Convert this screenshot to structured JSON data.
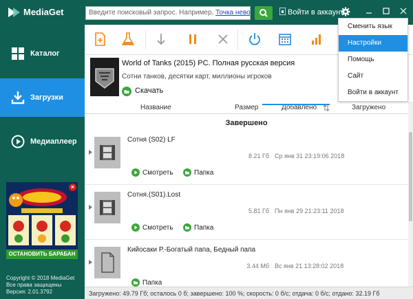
{
  "app": {
    "title": "MediaGet"
  },
  "search": {
    "placeholder": "Введите поисковый запрос. Например,",
    "example_link": "Точка невозврата"
  },
  "header": {
    "login": "Войти в аккаунт"
  },
  "sidebar": {
    "items": [
      {
        "label": "Каталог",
        "icon": "grid-icon"
      },
      {
        "label": "Загрузки",
        "icon": "download-icon",
        "active": true
      },
      {
        "label": "Медиаплеер",
        "icon": "play-icon"
      }
    ],
    "ad": {
      "button": "ОСТАНОВИТЬ БАРАБАН"
    },
    "copyright": [
      "Copyright © 2018 MediaGet",
      "Все права защищены",
      "Версия: 2.01.3792"
    ]
  },
  "banner": {
    "title": "World of Tanks (2015) PC. Полная русская версия",
    "subtitle": "Сотни танков, десятки карт, миллионы игроков",
    "download": "Скачать"
  },
  "columns": [
    "Название",
    "Размер",
    "Добавлено",
    "Загружено"
  ],
  "list": {
    "group": "Завершено",
    "rows": [
      {
        "name": "Сотня (S02) LF",
        "size": "8.21 Гб",
        "date": "Ср янв 31 23:19:06 2018",
        "watch": "Смотреть",
        "folder": "Папка",
        "type": "video"
      },
      {
        "name": "Сотня.(S01).Lost",
        "size": "5.81 Гб",
        "date": "Пн янв 29 21:23:11 2018",
        "watch": "Смотреть",
        "folder": "Папка",
        "type": "video"
      },
      {
        "name": "Кийосаки Р.-Богатый папа, Бедный папа",
        "size": "3.44 Мб",
        "date": "Вс янв 21 13:28:02 2018",
        "folder": "Папка",
        "type": "doc"
      }
    ]
  },
  "statusbar": "Загружено: 49.79 Гб; осталось 0 б; завершено: 100 %; скорость: 0 б/с; отдача: 0 б/с; отдано: 32.19 Гб",
  "menu": {
    "items": [
      "Сменить язык",
      "Настройки",
      "Помощь",
      "Сайт",
      "Войти в аккаунт"
    ],
    "active_index": 1
  },
  "colors": {
    "brand": "#0f5f52",
    "accent": "#1f8fe3",
    "green": "#3da63d",
    "toolbar_orange": "#f08a1c"
  }
}
